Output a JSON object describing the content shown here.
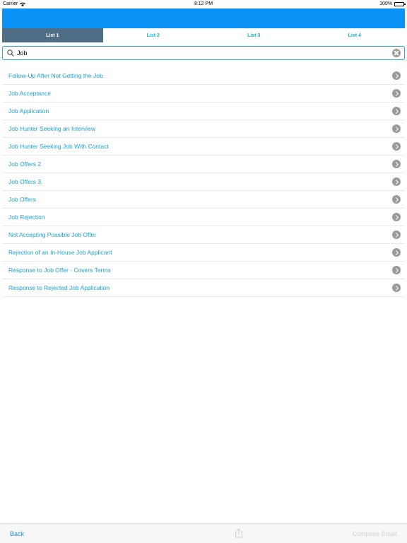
{
  "status_bar": {
    "carrier": "Carrier",
    "time": "8:12 PM",
    "battery": "100%"
  },
  "tabs": [
    {
      "label": "List 1",
      "active": true
    },
    {
      "label": "List 2",
      "active": false
    },
    {
      "label": "List 3",
      "active": false
    },
    {
      "label": "List 4",
      "active": false
    }
  ],
  "search": {
    "value": "Job",
    "icon": "search-icon",
    "clear_icon": "clear-icon"
  },
  "results": [
    "Follow-Up After Not Getting the Job",
    "Job Acceptance",
    "Job Application",
    "Job Hunter Seeking an Interview",
    "Job Hunter Seeking Job With Contact",
    "Job Offers 2",
    "Job Offers 3",
    "Job Offers",
    "Job Rejection",
    "Not Accepting Possible Job Offer",
    "Rejection of an In-House Job Applicant",
    "Response to Job Offer - Covers Terms",
    "Response to Rejected Job Application"
  ],
  "toolbar": {
    "back_label": "Back",
    "share_icon": "share-icon",
    "compose_label": "Compose Email"
  },
  "colors": {
    "nav_bar": "#0a93f5",
    "tab_active": "#4f6d85",
    "link": "#1aa2d4"
  }
}
